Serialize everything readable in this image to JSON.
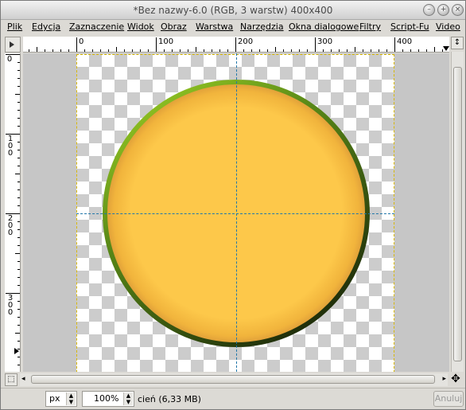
{
  "window": {
    "title": "*Bez nazwy-6.0 (RGB, 3 warstw) 400x400"
  },
  "menu": [
    {
      "label": "Plik"
    },
    {
      "label": "Edycja"
    },
    {
      "label": "Zaznaczenie"
    },
    {
      "label": "Widok"
    },
    {
      "label": "Obraz"
    },
    {
      "label": "Warstwa"
    },
    {
      "label": "Narzędzia"
    },
    {
      "label": "Okna dialogowe"
    },
    {
      "label": "Filtry"
    },
    {
      "label": "Script-Fu"
    },
    {
      "label": "Video"
    }
  ],
  "rulers": {
    "horizontal_labels": [
      "0",
      "100",
      "200",
      "300",
      "400"
    ],
    "vertical_labels": [
      "0",
      "100",
      "200",
      "300"
    ]
  },
  "status": {
    "unit": "px",
    "zoom": "100%",
    "message": "cień (6,33 MB)",
    "cancel_label": "Anuluj"
  },
  "image": {
    "fill_color": "#fdc84a",
    "ring_color_light": "#8cc21f",
    "ring_color_dark": "#1e2a0a",
    "guide_color": "#2277aa",
    "border_color": "#d8b800"
  }
}
